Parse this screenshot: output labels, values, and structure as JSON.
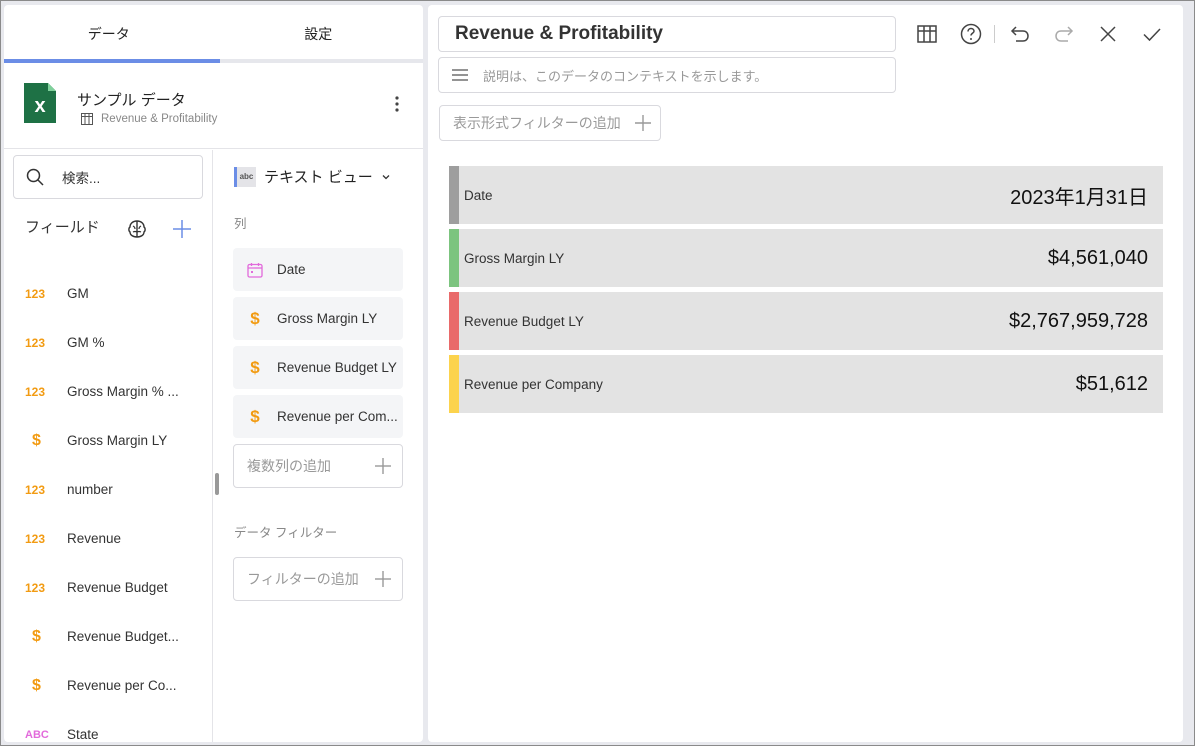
{
  "tabs": [
    {
      "label": "データ"
    },
    {
      "label": "設定"
    }
  ],
  "source": {
    "name": "サンプル データ",
    "sheet": "Revenue & Profitability"
  },
  "search": {
    "placeholder": "検索..."
  },
  "fields_header": "フィールド",
  "fields": [
    {
      "type": "123",
      "name": "GM"
    },
    {
      "type": "123",
      "name": "GM %"
    },
    {
      "type": "123",
      "name": "Gross Margin % ..."
    },
    {
      "type": "$",
      "name": "Gross Margin LY"
    },
    {
      "type": "123",
      "name": "number"
    },
    {
      "type": "123",
      "name": "Revenue"
    },
    {
      "type": "123",
      "name": "Revenue Budget"
    },
    {
      "type": "$",
      "name": "Revenue Budget..."
    },
    {
      "type": "$",
      "name": "Revenue per Co..."
    },
    {
      "type": "ABC",
      "name": "State"
    }
  ],
  "viz": {
    "icon_text": "abc",
    "label": "テキスト ビュー"
  },
  "columns_label": "列",
  "columns": [
    {
      "icon": "calendar-icon",
      "name": "Date"
    },
    {
      "icon": "dollar-icon",
      "name": "Gross Margin LY"
    },
    {
      "icon": "dollar-icon",
      "name": "Revenue Budget LY"
    },
    {
      "icon": "dollar-icon",
      "name": "Revenue per Com..."
    }
  ],
  "add_columns": "複数列の追加",
  "data_filter_label": "データ フィルター",
  "add_filter": "フィルターの追加",
  "title": "Revenue & Profitability",
  "description_placeholder": "説明は、このデータのコンテキストを示します。",
  "add_display_filter": "表示形式フィルターの追加",
  "kpis": [
    {
      "label": "Date",
      "value": "2023年1月31日",
      "color": "#9e9e9e"
    },
    {
      "label": "Gross Margin LY",
      "value": "$4,561,040",
      "color": "#7cc47f"
    },
    {
      "label": "Revenue Budget LY",
      "value": "$2,767,959,728",
      "color": "#e96a6a"
    },
    {
      "label": "Revenue per Company",
      "value": "$51,612",
      "color": "#fcd34d"
    }
  ],
  "colors": {
    "accent": "#6b8de6",
    "excel_green": "#1e7145",
    "field_number": "#f29b12",
    "field_text": "#e26adb"
  }
}
